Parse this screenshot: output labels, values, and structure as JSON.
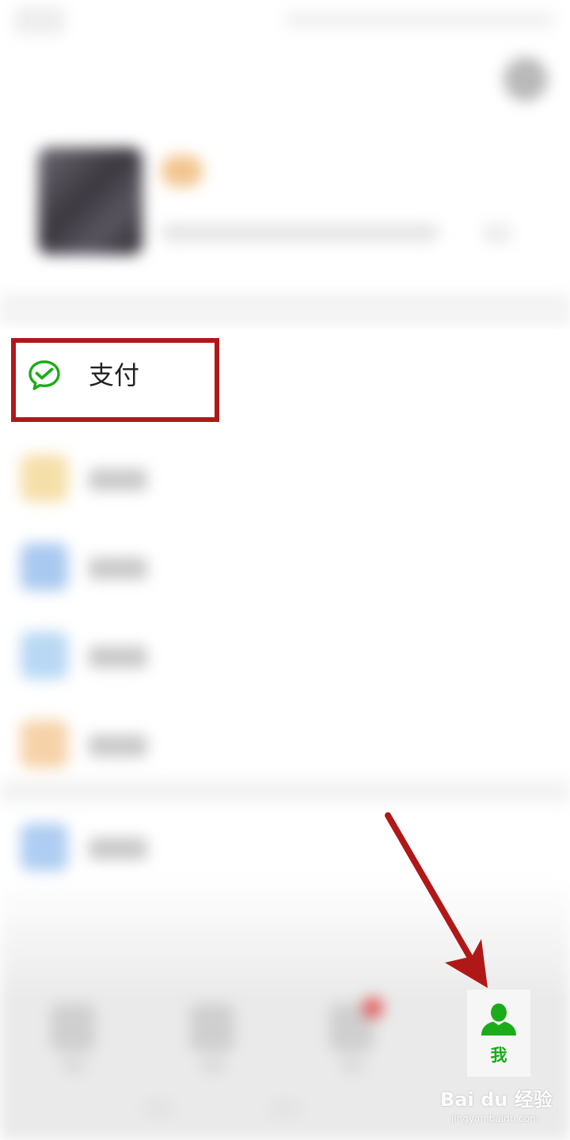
{
  "pay_row": {
    "label": "支付",
    "icon": "wechat-pay-icon",
    "icon_color": "#1aad19"
  },
  "tab_bar": {
    "me_label": "我",
    "me_icon": "person-icon",
    "active_color": "#1aad19"
  },
  "annotations": {
    "box_color": "#b01818",
    "arrow_color": "#b01818"
  },
  "watermark": {
    "main": "Bai du 经验",
    "sub": "jingyan.baidu.com"
  }
}
